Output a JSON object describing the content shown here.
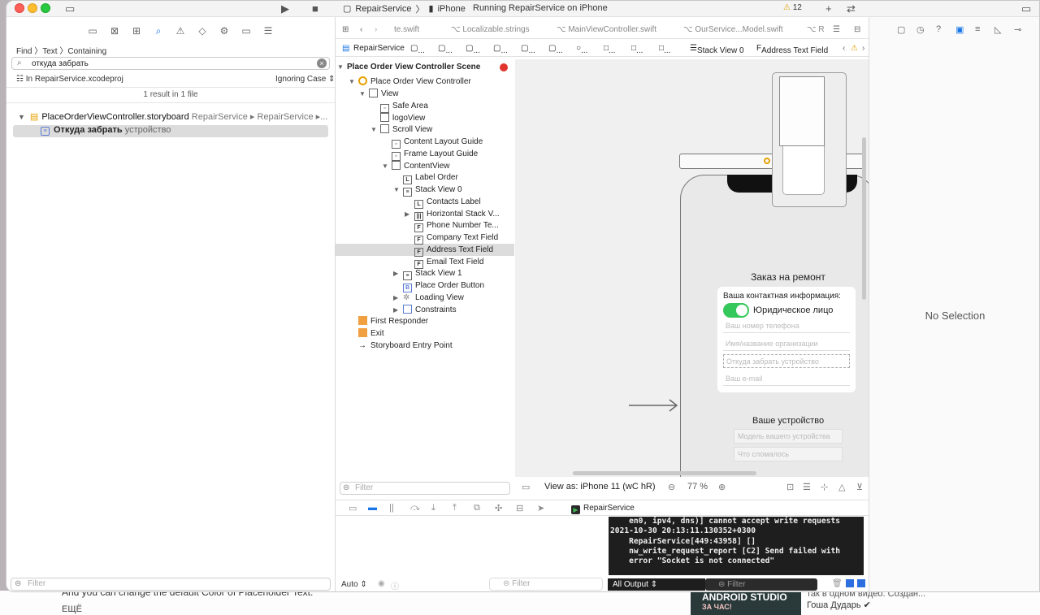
{
  "window": {
    "scheme_target": "RepairService",
    "scheme_device": "iPhone",
    "status": "Running RepairService on iPhone",
    "warning_count": "12"
  },
  "navigator": {
    "find_breadcrumb": "Find 〉Text 〉Containing",
    "search_value": "откуда забрать",
    "scope": "In RepairService.xcodeproj",
    "case_mode": "Ignoring Case ⇕",
    "summary": "1 result in 1 file",
    "result_file": "PlaceOrderViewController.storyboard",
    "result_path": "RepairService ▸ RepairService ▸...",
    "result_match_bold": "Откуда забрать",
    "result_match_rest": "устройство",
    "filter_placeholder": "Filter"
  },
  "editor": {
    "tabs": [
      "te.swift",
      "Localizable.strings",
      "MainViewController.swift",
      "OurService...Model.swift",
      "R"
    ],
    "jump": [
      "RepairService",
      "...",
      "...",
      "...",
      "...",
      "...",
      "...",
      "...",
      "...",
      "...",
      "Stack View 0",
      "Address Text Field"
    ],
    "outline": [
      {
        "label": "Place Order View Controller Scene",
        "kind": "scene"
      },
      {
        "label": "Place Order View Controller",
        "kind": "vc"
      },
      {
        "label": "View",
        "kind": "view"
      },
      {
        "label": "Safe Area",
        "kind": "guide"
      },
      {
        "label": "logoView",
        "kind": "view"
      },
      {
        "label": "Scroll View",
        "kind": "view"
      },
      {
        "label": "Content Layout Guide",
        "kind": "guide"
      },
      {
        "label": "Frame Layout Guide",
        "kind": "guide"
      },
      {
        "label": "ContentView",
        "kind": "view"
      },
      {
        "label": "Label Order",
        "kind": "label"
      },
      {
        "label": "Stack View 0",
        "kind": "stack"
      },
      {
        "label": "Contacts Label",
        "kind": "label"
      },
      {
        "label": "Horizontal Stack V...",
        "kind": "hstack"
      },
      {
        "label": "Phone Number Te...",
        "kind": "field"
      },
      {
        "label": "Company Text Field",
        "kind": "field"
      },
      {
        "label": "Address Text Field",
        "kind": "field"
      },
      {
        "label": "Email Text Field",
        "kind": "field"
      },
      {
        "label": "Stack View 1",
        "kind": "stack"
      },
      {
        "label": "Place Order Button",
        "kind": "button"
      },
      {
        "label": "Loading View",
        "kind": "loading"
      },
      {
        "label": "Constraints",
        "kind": "constraints"
      },
      {
        "label": "First Responder",
        "kind": "responder"
      },
      {
        "label": "Exit",
        "kind": "exit"
      },
      {
        "label": "Storyboard Entry Point",
        "kind": "entry"
      }
    ],
    "outline_filter": "Filter",
    "canvas": {
      "title": "Заказ на ремонт",
      "contact_header": "Ваша контактная информация:",
      "toggle_label": "Юридическое лицо",
      "toggle_on": true,
      "fields": [
        "Ваш номер телефона",
        "Имя/название организации",
        "Откуда забрать устройство",
        "Ваш e-mail"
      ],
      "device_header": "Ваше устройство",
      "device_fields": [
        "Модель вашего устройства",
        "Что сломалось"
      ]
    },
    "view_as": "View as: iPhone 11 (wC hR)",
    "zoom": "77 %"
  },
  "debug": {
    "process": "RepairService",
    "console": "    en0, ipv4, dns)] cannot accept write requests\n2021-10-30 20:13:11.130352+0300\n    RepairService[449:43958] []\n    nw_write_request_report [C2] Send failed with\n    error \"Socket is not connected\"",
    "auto": "Auto ⇕",
    "filter": "Filter",
    "output": "All Output ⇕",
    "console_filter": "Filter"
  },
  "inspector": {
    "no_selection": "No Selection"
  },
  "background": {
    "text1": "And you can change the default Color of Placeholder Text.",
    "text2": "ЕЩЁ",
    "ad_line1": "ANDROID STUDIO",
    "ad_line2": "ЗА ЧАС!",
    "author_top": "так в одном видео. Создан...",
    "author": "Гоша Дударь ✔"
  }
}
